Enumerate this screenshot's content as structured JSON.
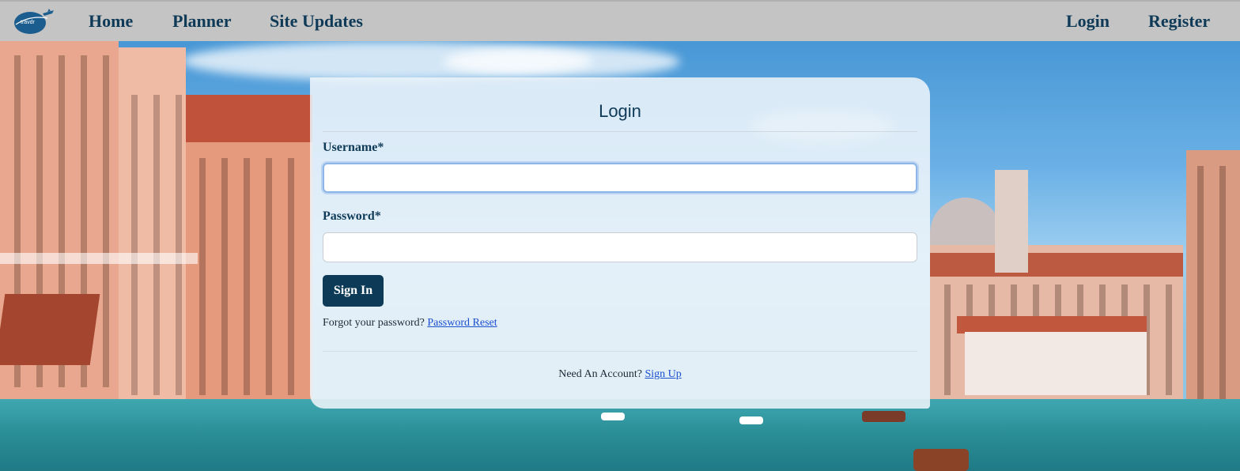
{
  "nav": {
    "logo_text": "travdr",
    "home": "Home",
    "planner": "Planner",
    "site_updates": "Site Updates",
    "login": "Login",
    "register": "Register"
  },
  "login_card": {
    "title": "Login",
    "username_label": "Username*",
    "username_value": "",
    "password_label": "Password*",
    "password_value": "",
    "sign_in_button": "Sign In",
    "forgot_text": "Forgot your password? ",
    "forgot_link": "Password Reset",
    "account_text": "Need An Account? ",
    "signup_link": "Sign Up"
  },
  "colors": {
    "navbar_bg": "#c4c4c4",
    "nav_text": "#0e3a57",
    "button_bg": "#0d3a56",
    "link": "#1a4fd0"
  },
  "icons": [
    "travdr-logo-icon"
  ]
}
